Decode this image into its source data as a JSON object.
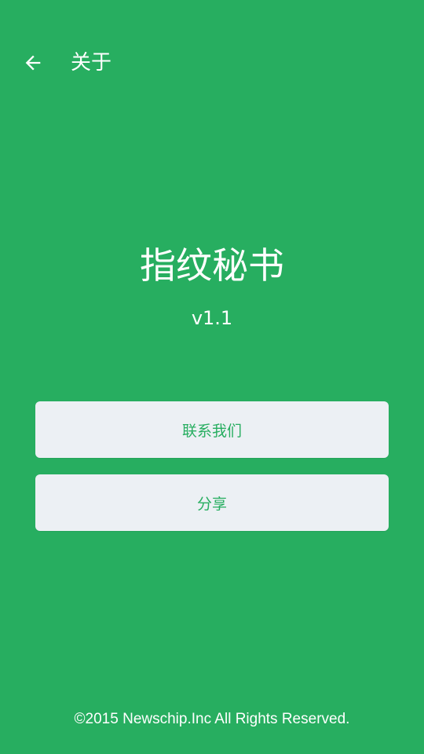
{
  "toolbar": {
    "back_icon": "arrow-left-icon",
    "title": "关于"
  },
  "app": {
    "name": "指纹秘书",
    "version": "v1.1"
  },
  "actions": {
    "contact_label": "联系我们",
    "share_label": "分享"
  },
  "footer": {
    "copyright": "©2015 Newschip.Inc All Rights Reserved."
  },
  "colors": {
    "background": "#27ae60",
    "button_background": "#ecf0f4",
    "button_text": "#27ae60",
    "text": "#ffffff"
  }
}
